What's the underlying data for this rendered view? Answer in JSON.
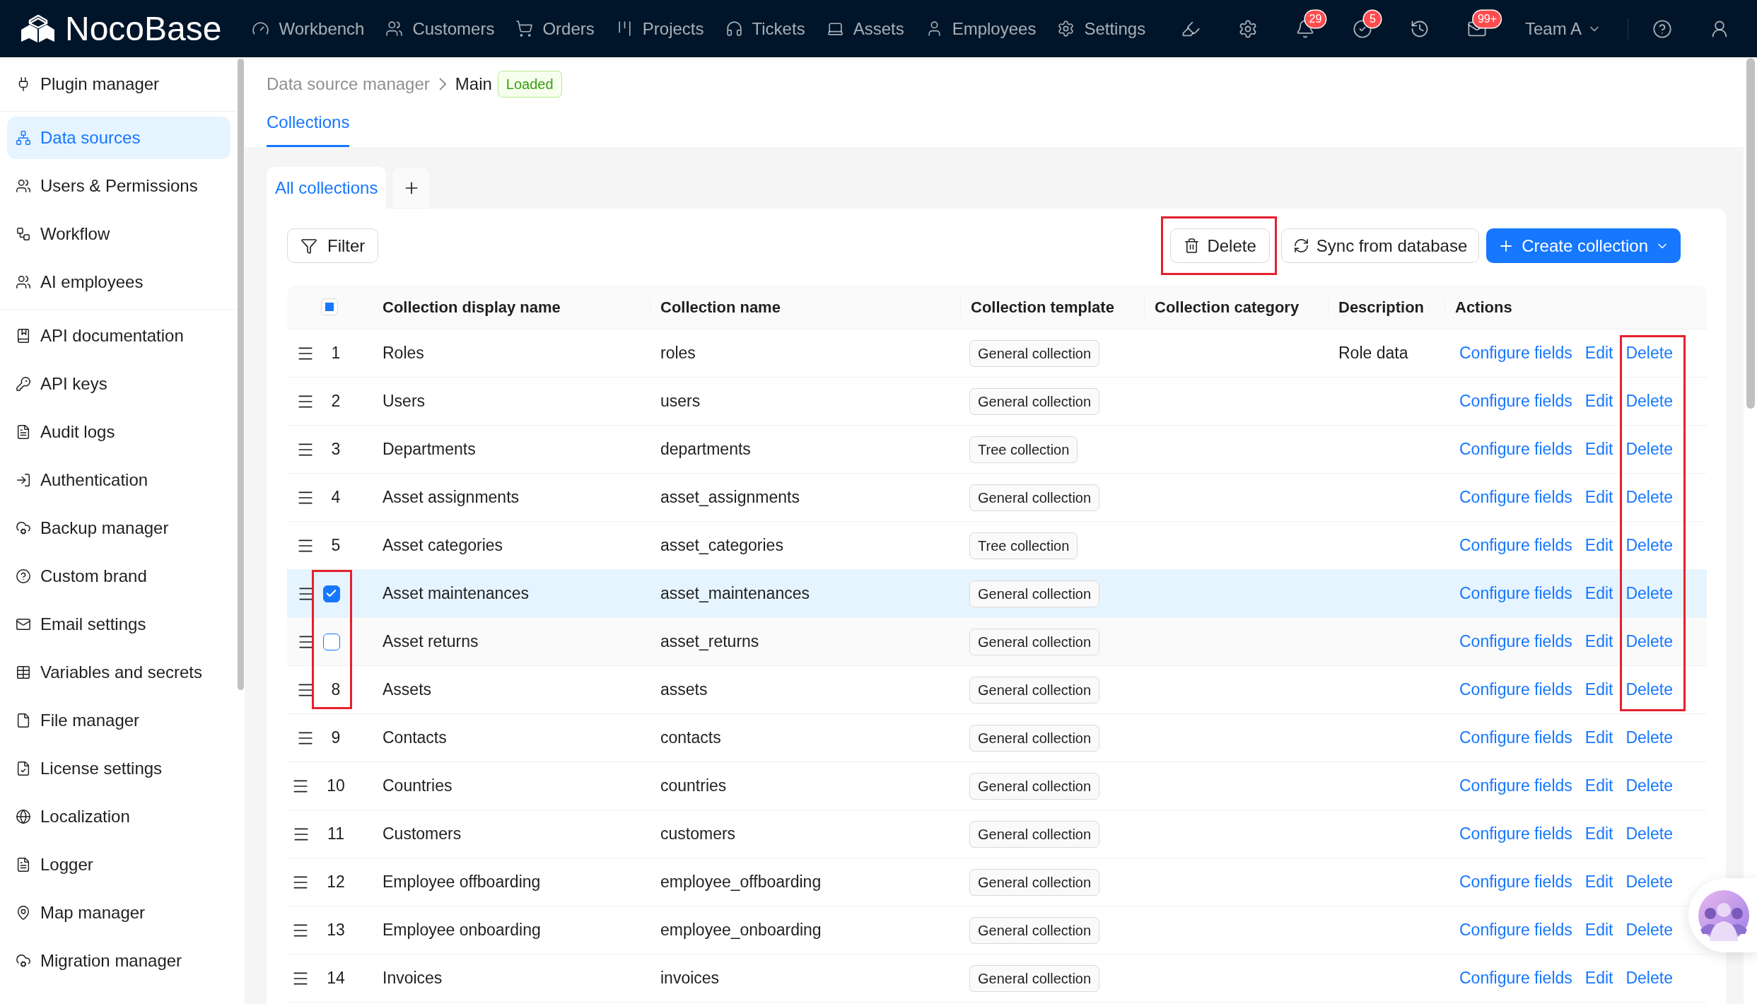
{
  "topbar": {
    "logo": "**Noco**Base",
    "nav": [
      "Workbench",
      "Customers",
      "Orders",
      "Projects",
      "Tickets",
      "Assets",
      "Employees",
      "Settings"
    ],
    "badges": {
      "notifications": "29",
      "tasks": "5",
      "messages": "99+"
    },
    "team": "Team A"
  },
  "sidebar": {
    "groups": [
      {
        "items": [
          {
            "label": "Plugin manager",
            "selected": false
          }
        ]
      },
      {
        "items": [
          {
            "label": "Data sources",
            "selected": true
          },
          {
            "label": "Users & Permissions",
            "selected": false
          },
          {
            "label": "Workflow",
            "selected": false
          },
          {
            "label": "AI employees",
            "selected": false
          }
        ]
      },
      {
        "items": [
          {
            "label": "API documentation",
            "selected": false
          },
          {
            "label": "API keys",
            "selected": false
          },
          {
            "label": "Audit logs",
            "selected": false
          },
          {
            "label": "Authentication",
            "selected": false
          },
          {
            "label": "Backup manager",
            "selected": false
          },
          {
            "label": "Custom brand",
            "selected": false
          },
          {
            "label": "Email settings",
            "selected": false
          },
          {
            "label": "Variables and secrets",
            "selected": false
          },
          {
            "label": "File manager",
            "selected": false
          },
          {
            "label": "License settings",
            "selected": false
          },
          {
            "label": "Localization",
            "selected": false
          },
          {
            "label": "Logger",
            "selected": false
          },
          {
            "label": "Map manager",
            "selected": false
          },
          {
            "label": "Migration manager",
            "selected": false
          }
        ]
      }
    ]
  },
  "breadcrumb": {
    "items": [
      "Data source manager",
      "Main"
    ],
    "status": {
      "label": "Loaded",
      "kind": "success"
    }
  },
  "page_tabs": [
    {
      "label": "Collections",
      "selected": true
    }
  ],
  "collection_tabs": [
    {
      "label": "All collections",
      "selected": true
    }
  ],
  "toolbar": {
    "filter": "Filter",
    "delete": {
      "label": "Delete",
      "annotated": true
    },
    "sync": "Sync from database",
    "create": "Create collection"
  },
  "table": {
    "header_checkbox": {
      "indeterminate": true
    },
    "columns": [
      "Collection display name",
      "Collection name",
      "Collection template",
      "Collection category",
      "Description",
      "Actions"
    ],
    "rows": [
      {
        "index": "1",
        "display_name": "Roles",
        "name": "roles",
        "template": "General collection",
        "description": "Role data",
        "actions": [
          "Configure fields",
          "Edit",
          "Delete"
        ],
        "selected": false,
        "hovered": false,
        "select_highlighted": false,
        "delete_highlighted": true
      },
      {
        "index": "2",
        "display_name": "Users",
        "name": "users",
        "template": "General collection",
        "actions": [
          "Configure fields",
          "Edit",
          "Delete"
        ],
        "selected": false,
        "hovered": false,
        "select_highlighted": false,
        "delete_highlighted": true
      },
      {
        "index": "3",
        "display_name": "Departments",
        "name": "departments",
        "template": "Tree collection",
        "actions": [
          "Configure fields",
          "Edit",
          "Delete"
        ],
        "selected": false,
        "hovered": false,
        "select_highlighted": false,
        "delete_highlighted": true
      },
      {
        "index": "4",
        "display_name": "Asset assignments",
        "name": "asset_assignments",
        "template": "General collection",
        "actions": [
          "Configure fields",
          "Edit",
          "Delete"
        ],
        "selected": false,
        "hovered": false,
        "select_highlighted": false,
        "delete_highlighted": true
      },
      {
        "index": "5",
        "display_name": "Asset categories",
        "name": "asset_categories",
        "template": "Tree collection",
        "actions": [
          "Configure fields",
          "Edit",
          "Delete"
        ],
        "selected": false,
        "hovered": false,
        "select_highlighted": false,
        "delete_highlighted": true
      },
      {
        "display_name": "Asset maintenances",
        "name": "asset_maintenances",
        "template": "General collection",
        "actions": [
          "Configure fields",
          "Edit",
          "Delete"
        ],
        "selected": true,
        "hovered": false,
        "select_highlighted": true,
        "delete_highlighted": true
      },
      {
        "display_name": "Asset returns",
        "name": "asset_returns",
        "template": "General collection",
        "actions": [
          "Configure fields",
          "Edit",
          "Delete"
        ],
        "selected": false,
        "hovered": true,
        "select_highlighted": true,
        "delete_highlighted": true
      },
      {
        "index": "8",
        "display_name": "Assets",
        "name": "assets",
        "template": "General collection",
        "actions": [
          "Configure fields",
          "Edit",
          "Delete"
        ],
        "selected": false,
        "hovered": false,
        "select_highlighted": true,
        "delete_highlighted": true
      },
      {
        "index": "9",
        "display_name": "Contacts",
        "name": "contacts",
        "template": "General collection",
        "actions": [
          "Configure fields",
          "Edit",
          "Delete"
        ],
        "selected": false,
        "hovered": false,
        "select_highlighted": false,
        "delete_highlighted": false
      },
      {
        "index": "10",
        "display_name": "Countries",
        "name": "countries",
        "template": "General collection",
        "actions": [
          "Configure fields",
          "Edit",
          "Delete"
        ],
        "selected": false,
        "hovered": false,
        "select_highlighted": false,
        "delete_highlighted": false
      },
      {
        "index": "11",
        "display_name": "Customers",
        "name": "customers",
        "template": "General collection",
        "actions": [
          "Configure fields",
          "Edit",
          "Delete"
        ],
        "selected": false,
        "hovered": false,
        "select_highlighted": false,
        "delete_highlighted": false
      },
      {
        "index": "12",
        "display_name": "Employee offboarding",
        "name": "employee_offboarding",
        "template": "General collection",
        "actions": [
          "Configure fields",
          "Edit",
          "Delete"
        ],
        "selected": false,
        "hovered": false,
        "select_highlighted": false,
        "delete_highlighted": false
      },
      {
        "index": "13",
        "display_name": "Employee onboarding",
        "name": "employee_onboarding",
        "template": "General collection",
        "actions": [
          "Configure fields",
          "Edit",
          "Delete"
        ],
        "selected": false,
        "hovered": false,
        "select_highlighted": false,
        "delete_highlighted": false
      },
      {
        "index": "14",
        "display_name": "Invoices",
        "name": "invoices",
        "template": "General collection",
        "actions": [
          "Configure fields",
          "Edit",
          "Delete"
        ],
        "selected": false,
        "hovered": false,
        "select_highlighted": false,
        "delete_highlighted": false
      }
    ]
  }
}
